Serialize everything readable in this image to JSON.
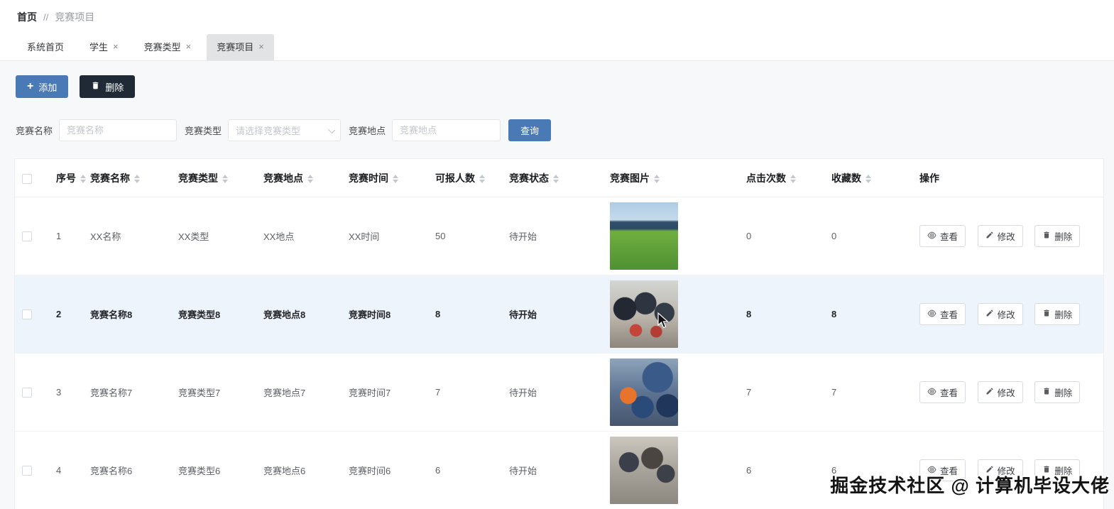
{
  "breadcrumb": {
    "home": "首页",
    "separator": "//",
    "current": "竞赛项目"
  },
  "tabs": [
    {
      "label": "系统首页",
      "closable": false,
      "active": false
    },
    {
      "label": "学生",
      "closable": true,
      "active": false
    },
    {
      "label": "竞赛类型",
      "closable": true,
      "active": false
    },
    {
      "label": "竞赛项目",
      "closable": true,
      "active": true
    }
  ],
  "toolbar": {
    "add_label": "添加",
    "delete_label": "删除"
  },
  "filters": {
    "name_label": "竞赛名称",
    "name_placeholder": "竞赛名称",
    "type_label": "竞赛类型",
    "type_placeholder": "请选择竞赛类型",
    "location_label": "竞赛地点",
    "location_placeholder": "竞赛地点",
    "search_label": "查询"
  },
  "table": {
    "columns": [
      {
        "label": "序号",
        "sortable": true
      },
      {
        "label": "竞赛名称",
        "sortable": true
      },
      {
        "label": "竞赛类型",
        "sortable": true
      },
      {
        "label": "竞赛地点",
        "sortable": true
      },
      {
        "label": "竞赛时间",
        "sortable": true
      },
      {
        "label": "可报人数",
        "sortable": true
      },
      {
        "label": "竞赛状态",
        "sortable": true
      },
      {
        "label": "竞赛图片",
        "sortable": true
      },
      {
        "label": "点击次数",
        "sortable": true
      },
      {
        "label": "收藏数",
        "sortable": true
      },
      {
        "label": "操作",
        "sortable": false
      }
    ],
    "rows": [
      {
        "no": "1",
        "name": "XX名称",
        "type": "XX类型",
        "location": "XX地点",
        "time": "XX时间",
        "capacity": "50",
        "status": "待开始",
        "image": "solar-field",
        "clicks": "0",
        "favorites": "0",
        "highlighted": false
      },
      {
        "no": "2",
        "name": "竞赛名称8",
        "type": "竞赛类型8",
        "location": "竞赛地点8",
        "time": "竞赛时间8",
        "capacity": "8",
        "status": "待开始",
        "image": "award-ceremony",
        "clicks": "8",
        "favorites": "8",
        "highlighted": true
      },
      {
        "no": "3",
        "name": "竞赛名称7",
        "type": "竞赛类型7",
        "location": "竞赛地点7",
        "time": "竞赛时间7",
        "capacity": "7",
        "status": "待开始",
        "image": "crowd-event",
        "clicks": "7",
        "favorites": "7",
        "highlighted": false
      },
      {
        "no": "4",
        "name": "竞赛名称6",
        "type": "竞赛类型6",
        "location": "竞赛地点6",
        "time": "竞赛时间6",
        "capacity": "6",
        "status": "待开始",
        "image": "workshop",
        "clicks": "6",
        "favorites": "6",
        "highlighted": false
      }
    ],
    "actions": {
      "view": "查看",
      "edit": "修改",
      "delete": "删除"
    }
  },
  "watermark": "掘金技术社区 @ 计算机毕设大佬",
  "colors": {
    "primary": "#4a7ab5",
    "dark_button": "#1f2a36",
    "row_highlight": "#edf4fb"
  }
}
